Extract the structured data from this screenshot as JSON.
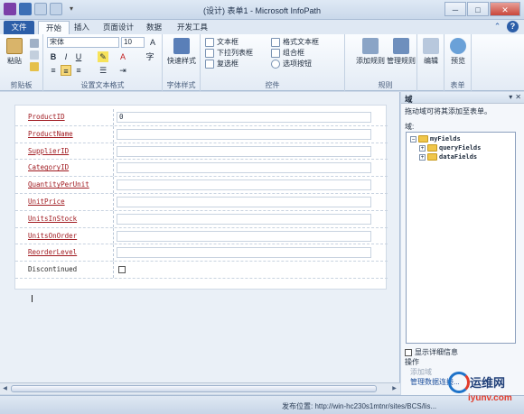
{
  "window": {
    "title": "(设计) 表单1 - Microsoft InfoPath"
  },
  "tabs": [
    {
      "label": "文件"
    },
    {
      "label": "开始"
    },
    {
      "label": "插入"
    },
    {
      "label": "页面设计"
    },
    {
      "label": "数据"
    },
    {
      "label": "开发工具"
    }
  ],
  "ribbon": {
    "clipboard": {
      "paste": "粘贴",
      "group": "剪贴板"
    },
    "font": {
      "family": "宋体",
      "size": "10",
      "group": "设置文本格式"
    },
    "styles": {
      "quick": "快速样式",
      "group": "字体样式"
    },
    "controls": {
      "items": [
        "文本框",
        "下拉列表框",
        "复选框",
        "格式文本框",
        "组合框",
        "选项按钮"
      ],
      "group": "控件"
    },
    "rules": {
      "add": "添加规则",
      "manage": "管理规则",
      "group": "规则"
    },
    "editing": {
      "edit": "编辑"
    },
    "form": {
      "preview": "预览",
      "group": "表单"
    }
  },
  "form": {
    "rows": [
      {
        "label": "ProductID",
        "value": "0"
      },
      {
        "label": "ProductName",
        "value": ""
      },
      {
        "label": "SupplierID",
        "value": ""
      },
      {
        "label": "CategoryID",
        "value": ""
      },
      {
        "label": "QuantityPerUnit",
        "value": ""
      },
      {
        "label": "UnitPrice",
        "value": ""
      },
      {
        "label": "UnitsInStock",
        "value": ""
      },
      {
        "label": "UnitsOnOrder",
        "value": ""
      },
      {
        "label": "ReorderLevel",
        "value": ""
      },
      {
        "label": "Discontinued",
        "value": ""
      }
    ]
  },
  "pane": {
    "title": "域",
    "description": "拖动域可将其添加至表单。",
    "field_label": "域:",
    "tree": {
      "root": "myFields",
      "children": [
        "queryFields",
        "dataFields"
      ]
    },
    "show_details": "显示详细信息",
    "actions_label": "操作",
    "add_field": "添加域",
    "manage_connections": "管理数据连接..."
  },
  "status": {
    "publish_location": "发布位置: http://win-hc230s1mtnr/sites/BCS/lis..."
  },
  "watermark": {
    "name": "运维网",
    "url": "iyunv.com"
  }
}
